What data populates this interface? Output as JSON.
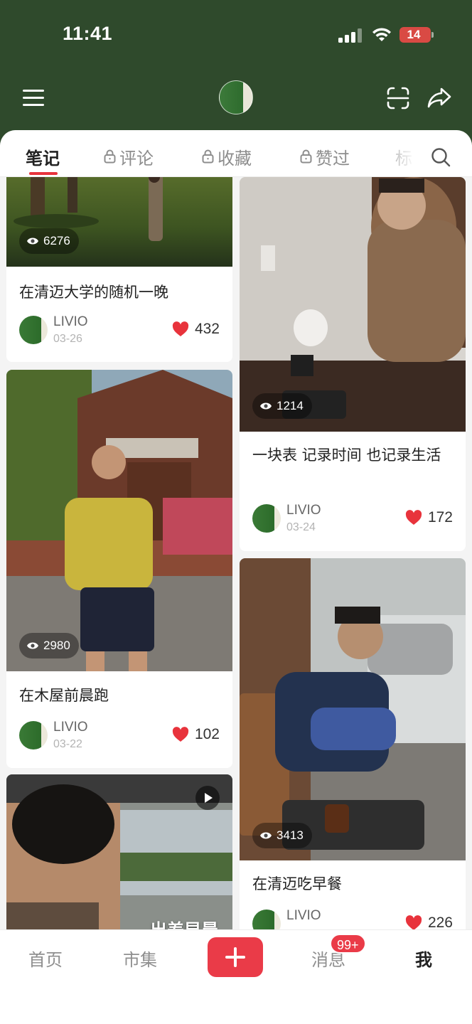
{
  "status_bar": {
    "time": "11:41",
    "battery": "14"
  },
  "tabs": [
    {
      "label": "笔记",
      "locked": false,
      "active": true
    },
    {
      "label": "评论",
      "locked": true,
      "active": false
    },
    {
      "label": "收藏",
      "locked": true,
      "active": false
    },
    {
      "label": "赞过",
      "locked": true,
      "active": false
    },
    {
      "label": "标",
      "locked": false,
      "active": false
    }
  ],
  "notes": [
    {
      "title": "在清迈大学的随机一晚",
      "views": "6276",
      "author": "LIVIO",
      "date": "03-26",
      "likes": "432"
    },
    {
      "title": "一块表 记录时间 也记录生活",
      "views": "1214",
      "author": "LIVIO",
      "date": "03-24",
      "likes": "172"
    },
    {
      "title": "在木屋前晨跑",
      "views": "2980",
      "author": "LIVIO",
      "date": "03-22",
      "likes": "102"
    },
    {
      "title": "在清迈吃早餐",
      "views": "3413",
      "author": "LIVIO",
      "date": "",
      "likes": "226"
    },
    {
      "overlay_text": "出差早晨",
      "is_video": true
    }
  ],
  "bottom_nav": {
    "home": "首页",
    "market": "市集",
    "messages": "消息",
    "messages_badge": "99+",
    "me": "我"
  },
  "colors": {
    "header_bg": "#2f4a2c",
    "accent": "#e8333c",
    "heart": "#e8333c"
  }
}
